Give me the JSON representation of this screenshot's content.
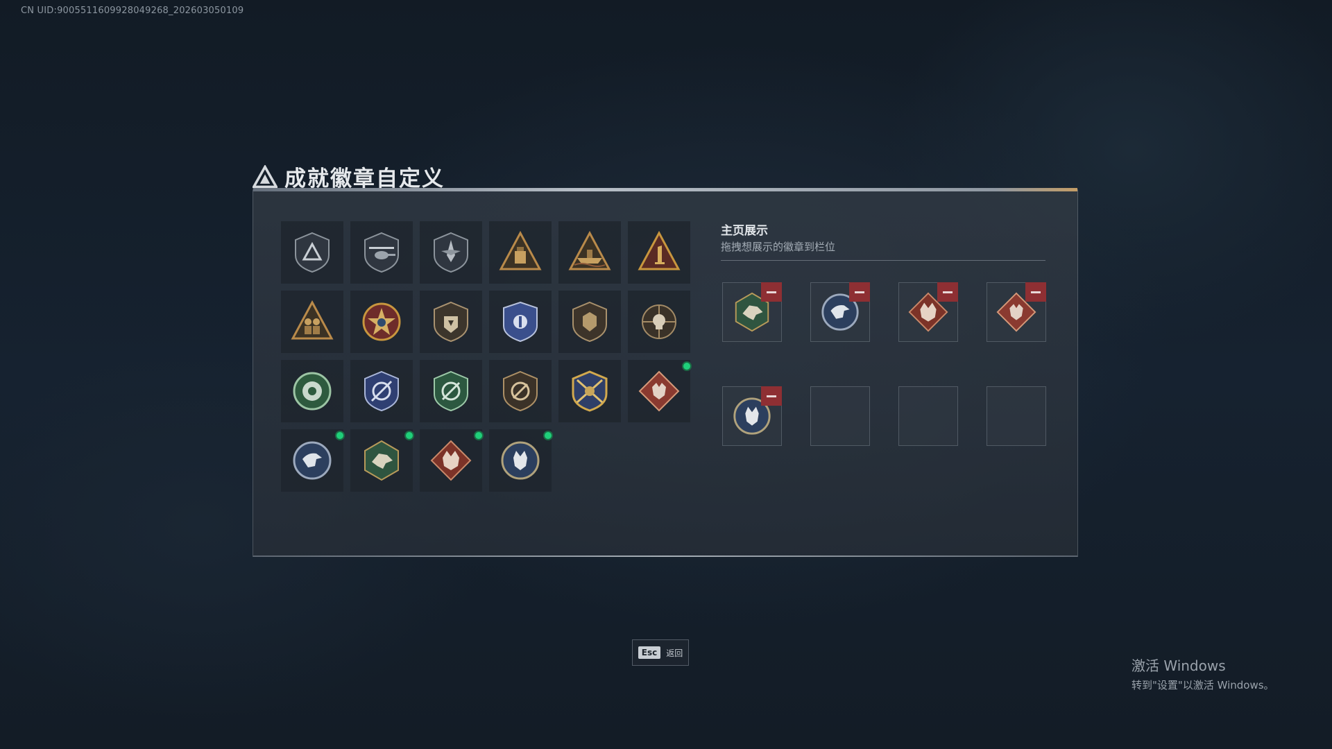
{
  "uid": "CN UID:9005511609928049268_202603050109",
  "header": {
    "title": "成就徽章自定义",
    "logo_icon": "triangle-emblem-icon"
  },
  "badges": [
    {
      "icon": "shield-triangle-icon",
      "new": false
    },
    {
      "icon": "helicopter-shield-icon",
      "new": false
    },
    {
      "icon": "jet-shield-icon",
      "new": false
    },
    {
      "icon": "tower-triangle-icon",
      "new": false
    },
    {
      "icon": "ship-triangle-icon",
      "new": false
    },
    {
      "icon": "number-one-triangle-icon",
      "new": false
    },
    {
      "icon": "soldiers-triangle-icon",
      "new": false
    },
    {
      "icon": "star-medal-icon",
      "new": false
    },
    {
      "icon": "fist-shield-icon",
      "new": false
    },
    {
      "icon": "blue-crest-icon",
      "new": false
    },
    {
      "icon": "lion-shield-icon",
      "new": false
    },
    {
      "icon": "skull-crosshair-icon",
      "new": false
    },
    {
      "icon": "tank-round-icon",
      "new": false
    },
    {
      "icon": "blue-wings-crest-icon",
      "new": false
    },
    {
      "icon": "green-crosshair-crest-icon",
      "new": false
    },
    {
      "icon": "rifle-shield-icon",
      "new": false
    },
    {
      "icon": "gold-rifles-crest-icon",
      "new": false
    },
    {
      "icon": "red-wolf-diamond-icon",
      "new": true
    },
    {
      "icon": "eagle-round-icon",
      "new": true
    },
    {
      "icon": "dragon-hexagon-icon",
      "new": true
    },
    {
      "icon": "wolf-red-icon",
      "new": true
    },
    {
      "icon": "wolf-round-icon",
      "new": true
    }
  ],
  "showcase": {
    "title": "主页展示",
    "subtitle": "拖拽想展示的徽章到栏位",
    "slots": [
      {
        "icon": "dragon-hexagon-icon",
        "filled": true
      },
      {
        "icon": "eagle-round-icon",
        "filled": true
      },
      {
        "icon": "wolf-red-icon",
        "filled": true
      },
      {
        "icon": "red-wolf-diamond-icon",
        "filled": true
      },
      {
        "icon": "wolf-round-icon",
        "filled": true
      },
      {
        "icon": "",
        "filled": false
      },
      {
        "icon": "",
        "filled": false
      },
      {
        "icon": "",
        "filled": false
      }
    ]
  },
  "footer": {
    "esc_key": "Esc",
    "esc_label": "返回"
  },
  "watermark": {
    "line1": "激活 Windows",
    "line2": "转到\"设置\"以激活 Windows。"
  },
  "colors": {
    "new_dot": "#1fcf7a",
    "remove": "#8e2f33",
    "gold": "#b98a4a"
  }
}
